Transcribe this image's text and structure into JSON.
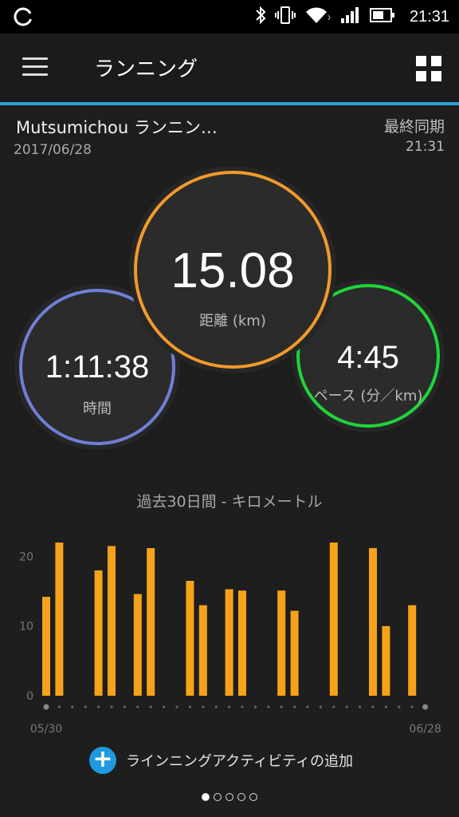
{
  "status_bar": {
    "time": "21:31"
  },
  "app_bar": {
    "title": "ランニング"
  },
  "activity": {
    "name": "Mutsumichou ランニン…",
    "date": "2017/06/28",
    "sync_label": "最終同期",
    "sync_time": "21:31"
  },
  "stats": {
    "distance": {
      "value": "15.08",
      "label": "距離 (km)"
    },
    "time": {
      "value": "1:11:38",
      "label": "時間"
    },
    "pace": {
      "value": "4:45",
      "label": "ペース (分／km)"
    }
  },
  "colors": {
    "accent": "#2a9fdd",
    "distance_ring": "#f29a2b",
    "time_ring": "#6f7fd6",
    "pace_ring": "#1fd43a",
    "bar": "#f7a21b"
  },
  "chart_data": {
    "type": "bar",
    "title": "過去30日間 - キロメートル",
    "ylim": [
      0,
      22
    ],
    "yticks": [
      0,
      10,
      20
    ],
    "x_start_label": "05/30",
    "x_end_label": "06/28",
    "days": 30,
    "bars": [
      {
        "day": 0,
        "value": 14.2
      },
      {
        "day": 1,
        "value": 22.0
      },
      {
        "day": 4,
        "value": 18.0
      },
      {
        "day": 5,
        "value": 21.5
      },
      {
        "day": 7,
        "value": 14.6
      },
      {
        "day": 8,
        "value": 21.2
      },
      {
        "day": 11,
        "value": 16.5
      },
      {
        "day": 12,
        "value": 13.0
      },
      {
        "day": 14,
        "value": 15.3
      },
      {
        "day": 15,
        "value": 15.1
      },
      {
        "day": 18,
        "value": 15.1
      },
      {
        "day": 19,
        "value": 12.2
      },
      {
        "day": 22,
        "value": 22.0
      },
      {
        "day": 25,
        "value": 21.2
      },
      {
        "day": 26,
        "value": 10.0
      },
      {
        "day": 28,
        "value": 13.0
      }
    ]
  },
  "add_activity": {
    "label": "ラインニングアクティビティの追加"
  },
  "pager": {
    "count": 5,
    "active": 0
  }
}
